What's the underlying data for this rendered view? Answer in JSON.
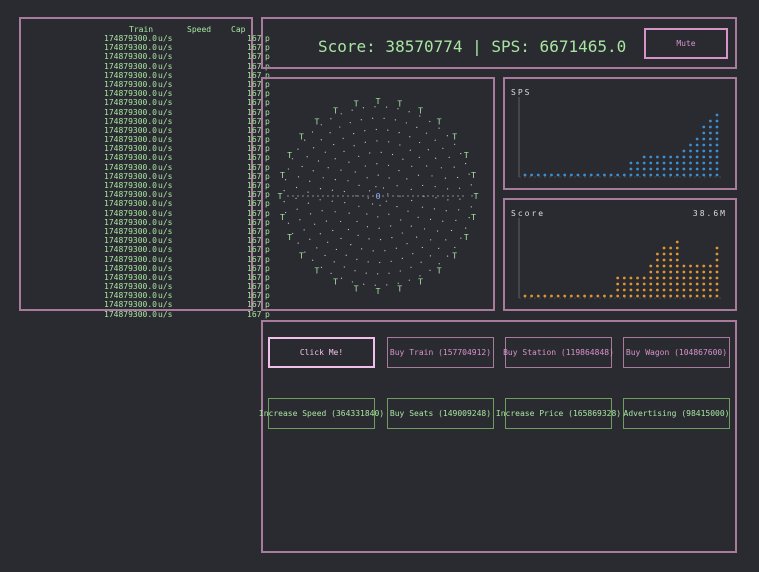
{
  "train_table": {
    "headers": {
      "train": "Train",
      "speed": "Speed",
      "cap": "Cap"
    },
    "rows": [
      {
        "speed": "174879300.0",
        "unit": "u/s",
        "cap": "167",
        "p": "p"
      },
      {
        "speed": "174879300.0",
        "unit": "u/s",
        "cap": "167",
        "p": "p"
      },
      {
        "speed": "174879300.0",
        "unit": "u/s",
        "cap": "167",
        "p": "p"
      },
      {
        "speed": "174879300.0",
        "unit": "u/s",
        "cap": "167",
        "p": "p"
      },
      {
        "speed": "174879300.0",
        "unit": "u/s",
        "cap": "167",
        "p": "p"
      },
      {
        "speed": "174879300.0",
        "unit": "u/s",
        "cap": "167",
        "p": "p"
      },
      {
        "speed": "174879300.0",
        "unit": "u/s",
        "cap": "167",
        "p": "p"
      },
      {
        "speed": "174879300.0",
        "unit": "u/s",
        "cap": "167",
        "p": "p"
      },
      {
        "speed": "174879300.0",
        "unit": "u/s",
        "cap": "167",
        "p": "p"
      },
      {
        "speed": "174879300.0",
        "unit": "u/s",
        "cap": "167",
        "p": "p"
      },
      {
        "speed": "174879300.0",
        "unit": "u/s",
        "cap": "167",
        "p": "p"
      },
      {
        "speed": "174879300.0",
        "unit": "u/s",
        "cap": "167",
        "p": "p"
      },
      {
        "speed": "174879300.0",
        "unit": "u/s",
        "cap": "167",
        "p": "p"
      },
      {
        "speed": "174879300.0",
        "unit": "u/s",
        "cap": "167",
        "p": "p"
      },
      {
        "speed": "174879300.0",
        "unit": "u/s",
        "cap": "167",
        "p": "p"
      },
      {
        "speed": "174879300.0",
        "unit": "u/s",
        "cap": "167",
        "p": "p"
      },
      {
        "speed": "174879300.0",
        "unit": "u/s",
        "cap": "167",
        "p": "p"
      },
      {
        "speed": "174879300.0",
        "unit": "u/s",
        "cap": "167",
        "p": "p"
      },
      {
        "speed": "174879300.0",
        "unit": "u/s",
        "cap": "167",
        "p": "p"
      },
      {
        "speed": "174879300.0",
        "unit": "u/s",
        "cap": "167",
        "p": "p"
      },
      {
        "speed": "174879300.0",
        "unit": "u/s",
        "cap": "167",
        "p": "p"
      },
      {
        "speed": "174879300.0",
        "unit": "u/s",
        "cap": "167",
        "p": "p"
      },
      {
        "speed": "174879300.0",
        "unit": "u/s",
        "cap": "167",
        "p": "p"
      },
      {
        "speed": "174879300.0",
        "unit": "u/s",
        "cap": "167",
        "p": "p"
      },
      {
        "speed": "174879300.0",
        "unit": "u/s",
        "cap": "167",
        "p": "p"
      },
      {
        "speed": "174879300.0",
        "unit": "u/s",
        "cap": "167",
        "p": "p"
      },
      {
        "speed": "174879300.0",
        "unit": "u/s",
        "cap": "167",
        "p": "p"
      },
      {
        "speed": "174879300.0",
        "unit": "u/s",
        "cap": "167",
        "p": "p"
      },
      {
        "speed": "174879300.0",
        "unit": "u/s",
        "cap": "167",
        "p": "p"
      },
      {
        "speed": "174879300.0",
        "unit": "u/s",
        "cap": "167",
        "p": "p"
      },
      {
        "speed": "174879300.0",
        "unit": "u/s",
        "cap": "167",
        "p": "p"
      }
    ]
  },
  "header": {
    "score_line": "Score: 38570774 | SPS: 6671465.0",
    "mute_label": "Mute"
  },
  "track": {
    "station_glyph": "O",
    "train_glyph": "T"
  },
  "charts": {
    "sps_title": "SPS",
    "score_title": "Score",
    "score_value": "38.6M",
    "sps_color": "#3b8fd0",
    "score_color": "#e0962a"
  },
  "chart_data": [
    {
      "type": "scatter",
      "title": "SPS",
      "values": [
        0.05,
        0.05,
        0.05,
        0.05,
        0.05,
        0.05,
        0.05,
        0.05,
        0.05,
        0.05,
        0.05,
        0.05,
        0.05,
        0.05,
        0.05,
        0.05,
        0.18,
        0.18,
        0.28,
        0.28,
        0.28,
        0.28,
        0.28,
        0.28,
        0.35,
        0.4,
        0.5,
        0.62,
        0.72,
        0.8
      ],
      "ylim": [
        0,
        1
      ]
    },
    {
      "type": "scatter",
      "title": "Score",
      "values": [
        0.03,
        0.03,
        0.03,
        0.03,
        0.03,
        0.03,
        0.03,
        0.03,
        0.03,
        0.03,
        0.03,
        0.03,
        0.03,
        0.03,
        0.25,
        0.25,
        0.25,
        0.25,
        0.3,
        0.42,
        0.55,
        0.6,
        0.65,
        0.7,
        0.45,
        0.45,
        0.45,
        0.45,
        0.45,
        0.6
      ],
      "ylim": [
        0,
        1
      ]
    }
  ],
  "shop": {
    "click_me": "Click Me!",
    "buy_train": "Buy Train (157704912)",
    "buy_station": "Buy Station (119864848)",
    "buy_wagon": "Buy Wagon (104867600)",
    "increase_speed": "Increase Speed (364331840)",
    "buy_seats": "Buy Seats (149009248)",
    "increase_price": "Increase Price (165869328)",
    "advertising": "Advertising (98415000)"
  }
}
